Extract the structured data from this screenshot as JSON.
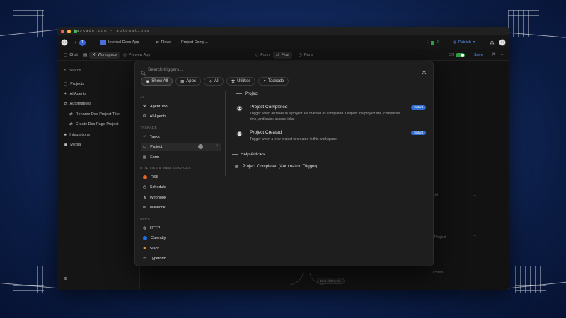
{
  "window": {
    "url": "taskade.com - automations",
    "traffic_lights": [
      "#ff5f57",
      "#febc2e",
      "#28c840"
    ]
  },
  "topbar": {
    "workspace_initial": "T",
    "app_name": "Internal Docs App",
    "flows_label": "Flows",
    "project_label": "Project Comp...",
    "count": "0",
    "publish_label": "Publish"
  },
  "subbar": {
    "chat": "Chat",
    "workspace": "Workspace",
    "preview": "Preview App",
    "form": "Form",
    "flow": "Flow",
    "runs": "Runs",
    "toggle_label": "Off",
    "save": "Save"
  },
  "sidebar": {
    "search": "Search...",
    "items": [
      {
        "label": "Projects",
        "icon": "projects-icon"
      },
      {
        "label": "AI Agents",
        "icon": "ai-agents-icon"
      },
      {
        "label": "Automations",
        "icon": "automations-icon"
      },
      {
        "label": "Rename Doc Project Title",
        "icon": "flow-icon"
      },
      {
        "label": "Create Doc Page Project",
        "icon": "flow-icon"
      },
      {
        "label": "Integrations",
        "icon": "integrations-icon"
      },
      {
        "label": "Media",
        "icon": "media-icon"
      }
    ]
  },
  "canvas": {
    "fragment_1": "back)",
    "fragment_2": "up Project",
    "fragment_3": "l Step",
    "end_label": "End of Branch"
  },
  "modal": {
    "search_placeholder": "Search triggers...",
    "filters": [
      {
        "label": "Show All",
        "icon": "eye-icon",
        "active": true
      },
      {
        "label": "Apps",
        "icon": "apps-icon",
        "active": false
      },
      {
        "label": "AI",
        "icon": "sparkle-icon",
        "active": false
      },
      {
        "label": "Utilities",
        "icon": "utilities-icon",
        "active": false
      },
      {
        "label": "Taskade",
        "icon": "taskade-icon",
        "active": false
      }
    ],
    "sections": {
      "ai": "AI",
      "taskade": "TASKADE",
      "utilities": "UTILITIES & WEB SERVICES",
      "apps": "APPS"
    },
    "ai_items": [
      "Agent Tool",
      "AI Agents"
    ],
    "taskade_items": [
      "Tasks",
      "Project",
      "Form"
    ],
    "utility_items": [
      "RSS",
      "Schedule",
      "Webhook",
      "Mailhook"
    ],
    "app_items": [
      "HTTP",
      "Calendly",
      "Slack",
      "Typeform"
    ],
    "right": {
      "project_heading": "Project",
      "triggers": [
        {
          "title": "Project Completed",
          "description": "Trigger when all tasks in a project are marked as completed. Outputs the project title, completion time, and quick-access links.",
          "badge": "Instant"
        },
        {
          "title": "Project Created",
          "description": "Trigger when a new project is created in this workspace.",
          "badge": "Instant"
        }
      ],
      "help_heading": "Help Articles",
      "help_items": [
        "Project Completed (Automation Trigger)"
      ]
    }
  },
  "colors": {
    "accent": "#2f6fd6",
    "rss": "#e8622c",
    "calendly": "#1e6fe0",
    "toggle": "#2ea043"
  }
}
